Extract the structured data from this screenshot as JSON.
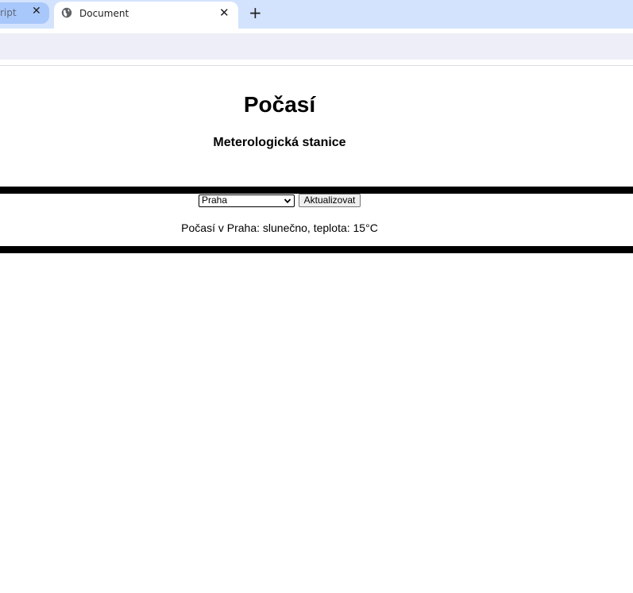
{
  "browser": {
    "tabs": [
      {
        "label": "ript.js",
        "active": false
      },
      {
        "label": "Document",
        "active": true
      }
    ],
    "new_tab_label": "+"
  },
  "page": {
    "title": "Počasí",
    "subtitle": "Meterologická stanice",
    "city_select": {
      "selected": "Praha"
    },
    "refresh_button_label": "Aktualizovat",
    "weather_text": "Počasí v Praha: slunečno, teplota: 15°C"
  },
  "colors": {
    "tabstrip": "#d3e3fd",
    "inactive_tab": "#a8c7fa",
    "omnibox": "#edeef7",
    "bars": "#000000"
  }
}
